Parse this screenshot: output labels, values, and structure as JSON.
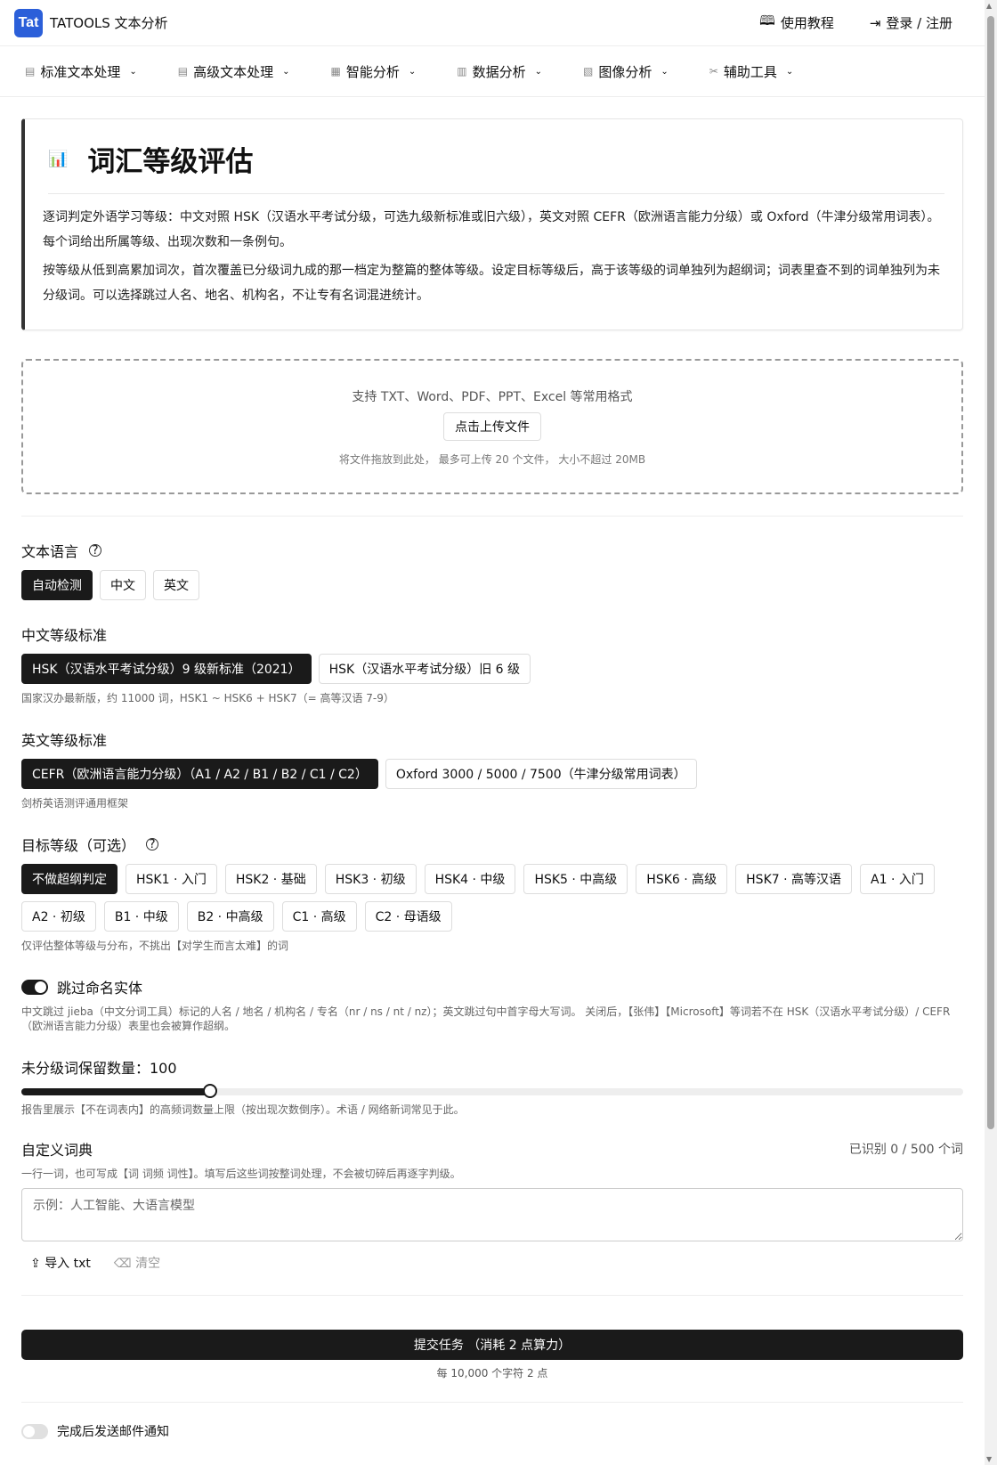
{
  "header": {
    "logo": "Tat",
    "brand": "TATOOLS 文本分析",
    "tutorial": "使用教程",
    "login": "登录 / 注册"
  },
  "nav": [
    {
      "label": "标准文本处理",
      "icon": "document-icon"
    },
    {
      "label": "高级文本处理",
      "icon": "document-search-icon"
    },
    {
      "label": "智能分析",
      "icon": "brain-icon"
    },
    {
      "label": "数据分析",
      "icon": "chart-icon"
    },
    {
      "label": "图像分析",
      "icon": "image-icon"
    },
    {
      "label": "辅助工具",
      "icon": "tools-icon"
    }
  ],
  "intro": {
    "title": "词汇等级评估",
    "p1": "逐词判定外语学习等级：中文对照 HSK（汉语水平考试分级，可选九级新标准或旧六级），英文对照 CEFR（欧洲语言能力分级）或 Oxford（牛津分级常用词表）。每个词给出所属等级、出现次数和一条例句。",
    "p2": "按等级从低到高累加词次，首次覆盖已分级词九成的那一档定为整篇的整体等级。设定目标等级后，高于该等级的词单独列为超纲词；词表里查不到的词单独列为未分级词。可以选择跳过人名、地名、机构名，不让专有名词混进统计。"
  },
  "upload": {
    "formats": "支持 TXT、Word、PDF、PPT、Excel 等常用格式",
    "button": "点击上传文件",
    "hint": "将文件拖放到此处， 最多可上传 20 个文件， 大小不超过 20MB"
  },
  "language": {
    "label": "文本语言",
    "options": [
      "自动检测",
      "中文",
      "英文"
    ]
  },
  "zh_standard": {
    "label": "中文等级标准",
    "options": [
      "HSK（汉语水平考试分级）9 级新标准（2021）",
      "HSK（汉语水平考试分级）旧 6 级"
    ],
    "help": "国家汉办最新版，约 11000 词，HSK1 ~ HSK6 + HSK7（= 高等汉语 7-9）"
  },
  "en_standard": {
    "label": "英文等级标准",
    "options": [
      "CEFR（欧洲语言能力分级）（A1 / A2 / B1 / B2 / C1 / C2）",
      "Oxford 3000 / 5000 / 7500（牛津分级常用词表）"
    ],
    "help": "剑桥英语测评通用框架"
  },
  "target": {
    "label": "目标等级（可选）",
    "options": [
      "不做超纲判定",
      "HSK1 · 入门",
      "HSK2 · 基础",
      "HSK3 · 初级",
      "HSK4 · 中级",
      "HSK5 · 中高级",
      "HSK6 · 高级",
      "HSK7 · 高等汉语",
      "A1 · 入门",
      "A2 · 初级",
      "B1 · 中级",
      "B2 · 中高级",
      "C1 · 高级",
      "C2 · 母语级"
    ],
    "help": "仅评估整体等级与分布，不挑出【对学生而言太难】的词"
  },
  "ner": {
    "label": "跳过命名实体",
    "help": "中文跳过 jieba（中文分词工具）标记的人名 / 地名 / 机构名 / 专名（nr / ns / nt / nz）；英文跳过句中首字母大写词。 关闭后，【张伟】【Microsoft】等词若不在 HSK（汉语水平考试分级）/ CEFR（欧洲语言能力分级）表里也会被算作超纲。"
  },
  "unclassified": {
    "label": "未分级词保留数量：100",
    "value": 100,
    "max": 500,
    "help": "报告里展示【不在词表内】的高频词数量上限（按出现次数倒序）。术语 / 网络新词常见于此。"
  },
  "dict": {
    "label": "自定义词典",
    "count": "已识别 0 / 500 个词",
    "help": "一行一词，也可写成【词 词频 词性】。填写后这些词按整词处理，不会被切碎后再逐字判级。",
    "placeholder": "示例：人工智能、大语言模型",
    "import": "导入 txt",
    "clear": "清空"
  },
  "submit": {
    "label": "提交任务 （消耗 2 点算力）",
    "note": "每 10,000 个字符 2 点"
  },
  "mail": {
    "label": "完成后发送邮件通知"
  }
}
